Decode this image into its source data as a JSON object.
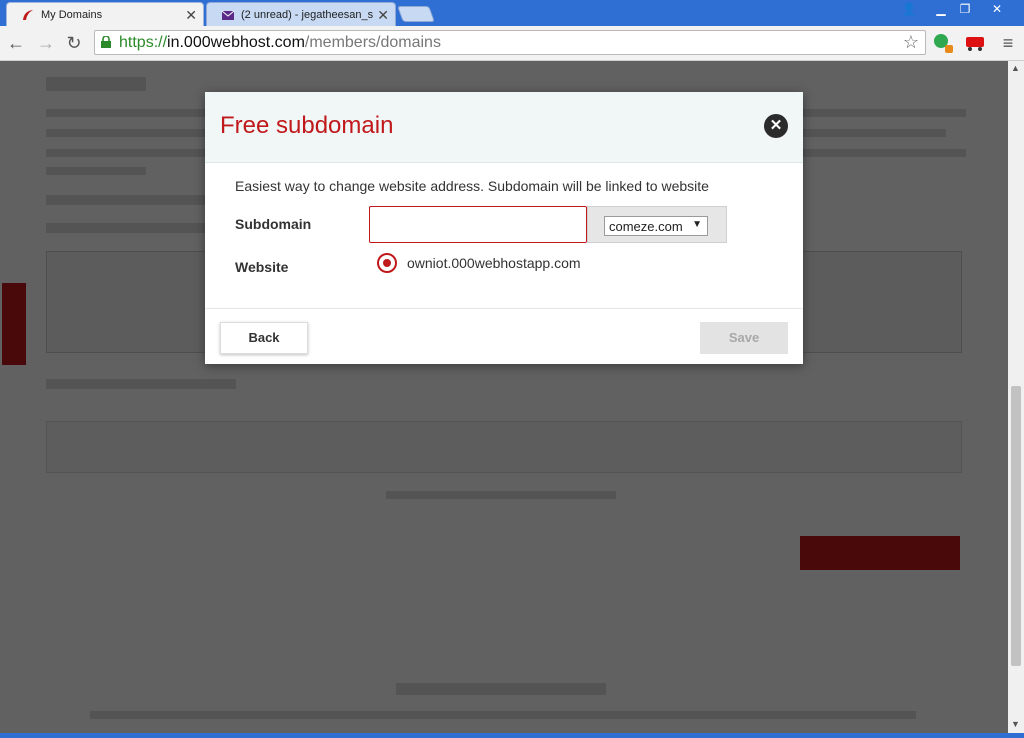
{
  "browser": {
    "tabs": [
      {
        "title": "My Domains",
        "active": true
      },
      {
        "title": "(2 unread) - jegatheesan_s",
        "active": false
      }
    ],
    "url": {
      "scheme": "https://",
      "host": "in.000webhost.com",
      "path": "/members/domains"
    }
  },
  "modal": {
    "title": "Free subdomain",
    "description": "Easiest way to change website address. Subdomain will be linked to website",
    "subdomain_label": "Subdomain",
    "subdomain_value": "",
    "domain_selected": "comeze.com",
    "website_label": "Website",
    "website_option": "owniot.000webhostapp.com",
    "back_label": "Back",
    "save_label": "Save"
  },
  "colors": {
    "accent": "#c0191c",
    "chrome_blue": "#2f6fd3"
  }
}
